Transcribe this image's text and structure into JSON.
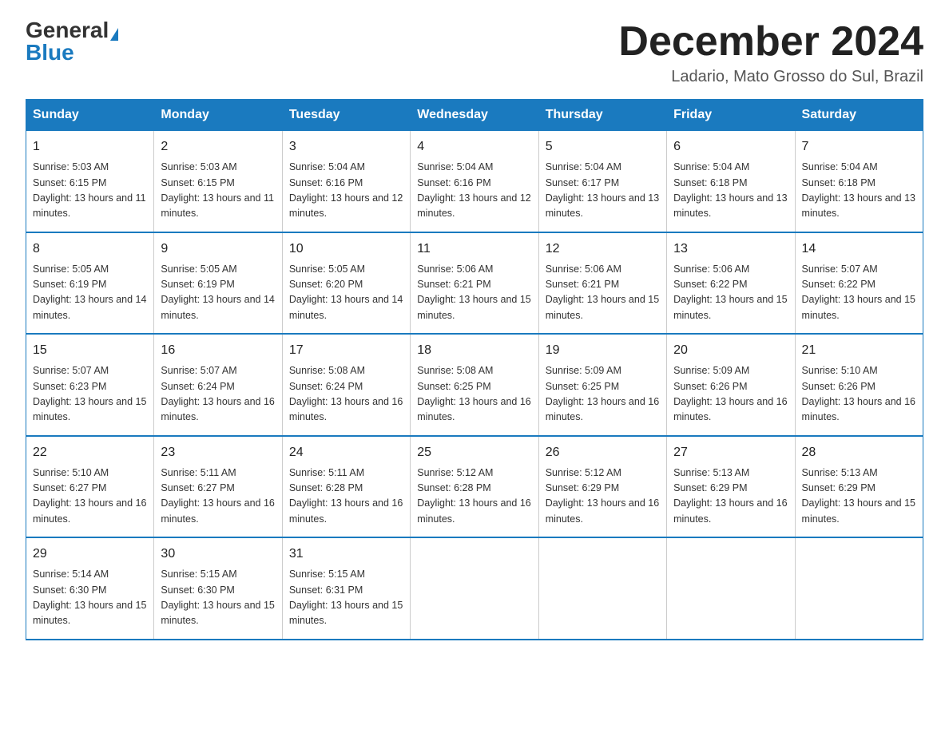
{
  "header": {
    "logo_general": "General",
    "logo_blue": "Blue",
    "title": "December 2024",
    "location": "Ladario, Mato Grosso do Sul, Brazil"
  },
  "weekdays": [
    "Sunday",
    "Monday",
    "Tuesday",
    "Wednesday",
    "Thursday",
    "Friday",
    "Saturday"
  ],
  "weeks": [
    [
      {
        "day": "1",
        "sunrise": "5:03 AM",
        "sunset": "6:15 PM",
        "daylight": "13 hours and 11 minutes."
      },
      {
        "day": "2",
        "sunrise": "5:03 AM",
        "sunset": "6:15 PM",
        "daylight": "13 hours and 11 minutes."
      },
      {
        "day": "3",
        "sunrise": "5:04 AM",
        "sunset": "6:16 PM",
        "daylight": "13 hours and 12 minutes."
      },
      {
        "day": "4",
        "sunrise": "5:04 AM",
        "sunset": "6:16 PM",
        "daylight": "13 hours and 12 minutes."
      },
      {
        "day": "5",
        "sunrise": "5:04 AM",
        "sunset": "6:17 PM",
        "daylight": "13 hours and 13 minutes."
      },
      {
        "day": "6",
        "sunrise": "5:04 AM",
        "sunset": "6:18 PM",
        "daylight": "13 hours and 13 minutes."
      },
      {
        "day": "7",
        "sunrise": "5:04 AM",
        "sunset": "6:18 PM",
        "daylight": "13 hours and 13 minutes."
      }
    ],
    [
      {
        "day": "8",
        "sunrise": "5:05 AM",
        "sunset": "6:19 PM",
        "daylight": "13 hours and 14 minutes."
      },
      {
        "day": "9",
        "sunrise": "5:05 AM",
        "sunset": "6:19 PM",
        "daylight": "13 hours and 14 minutes."
      },
      {
        "day": "10",
        "sunrise": "5:05 AM",
        "sunset": "6:20 PM",
        "daylight": "13 hours and 14 minutes."
      },
      {
        "day": "11",
        "sunrise": "5:06 AM",
        "sunset": "6:21 PM",
        "daylight": "13 hours and 15 minutes."
      },
      {
        "day": "12",
        "sunrise": "5:06 AM",
        "sunset": "6:21 PM",
        "daylight": "13 hours and 15 minutes."
      },
      {
        "day": "13",
        "sunrise": "5:06 AM",
        "sunset": "6:22 PM",
        "daylight": "13 hours and 15 minutes."
      },
      {
        "day": "14",
        "sunrise": "5:07 AM",
        "sunset": "6:22 PM",
        "daylight": "13 hours and 15 minutes."
      }
    ],
    [
      {
        "day": "15",
        "sunrise": "5:07 AM",
        "sunset": "6:23 PM",
        "daylight": "13 hours and 15 minutes."
      },
      {
        "day": "16",
        "sunrise": "5:07 AM",
        "sunset": "6:24 PM",
        "daylight": "13 hours and 16 minutes."
      },
      {
        "day": "17",
        "sunrise": "5:08 AM",
        "sunset": "6:24 PM",
        "daylight": "13 hours and 16 minutes."
      },
      {
        "day": "18",
        "sunrise": "5:08 AM",
        "sunset": "6:25 PM",
        "daylight": "13 hours and 16 minutes."
      },
      {
        "day": "19",
        "sunrise": "5:09 AM",
        "sunset": "6:25 PM",
        "daylight": "13 hours and 16 minutes."
      },
      {
        "day": "20",
        "sunrise": "5:09 AM",
        "sunset": "6:26 PM",
        "daylight": "13 hours and 16 minutes."
      },
      {
        "day": "21",
        "sunrise": "5:10 AM",
        "sunset": "6:26 PM",
        "daylight": "13 hours and 16 minutes."
      }
    ],
    [
      {
        "day": "22",
        "sunrise": "5:10 AM",
        "sunset": "6:27 PM",
        "daylight": "13 hours and 16 minutes."
      },
      {
        "day": "23",
        "sunrise": "5:11 AM",
        "sunset": "6:27 PM",
        "daylight": "13 hours and 16 minutes."
      },
      {
        "day": "24",
        "sunrise": "5:11 AM",
        "sunset": "6:28 PM",
        "daylight": "13 hours and 16 minutes."
      },
      {
        "day": "25",
        "sunrise": "5:12 AM",
        "sunset": "6:28 PM",
        "daylight": "13 hours and 16 minutes."
      },
      {
        "day": "26",
        "sunrise": "5:12 AM",
        "sunset": "6:29 PM",
        "daylight": "13 hours and 16 minutes."
      },
      {
        "day": "27",
        "sunrise": "5:13 AM",
        "sunset": "6:29 PM",
        "daylight": "13 hours and 16 minutes."
      },
      {
        "day": "28",
        "sunrise": "5:13 AM",
        "sunset": "6:29 PM",
        "daylight": "13 hours and 15 minutes."
      }
    ],
    [
      {
        "day": "29",
        "sunrise": "5:14 AM",
        "sunset": "6:30 PM",
        "daylight": "13 hours and 15 minutes."
      },
      {
        "day": "30",
        "sunrise": "5:15 AM",
        "sunset": "6:30 PM",
        "daylight": "13 hours and 15 minutes."
      },
      {
        "day": "31",
        "sunrise": "5:15 AM",
        "sunset": "6:31 PM",
        "daylight": "13 hours and 15 minutes."
      },
      {
        "day": "",
        "sunrise": "",
        "sunset": "",
        "daylight": ""
      },
      {
        "day": "",
        "sunrise": "",
        "sunset": "",
        "daylight": ""
      },
      {
        "day": "",
        "sunrise": "",
        "sunset": "",
        "daylight": ""
      },
      {
        "day": "",
        "sunrise": "",
        "sunset": "",
        "daylight": ""
      }
    ]
  ]
}
